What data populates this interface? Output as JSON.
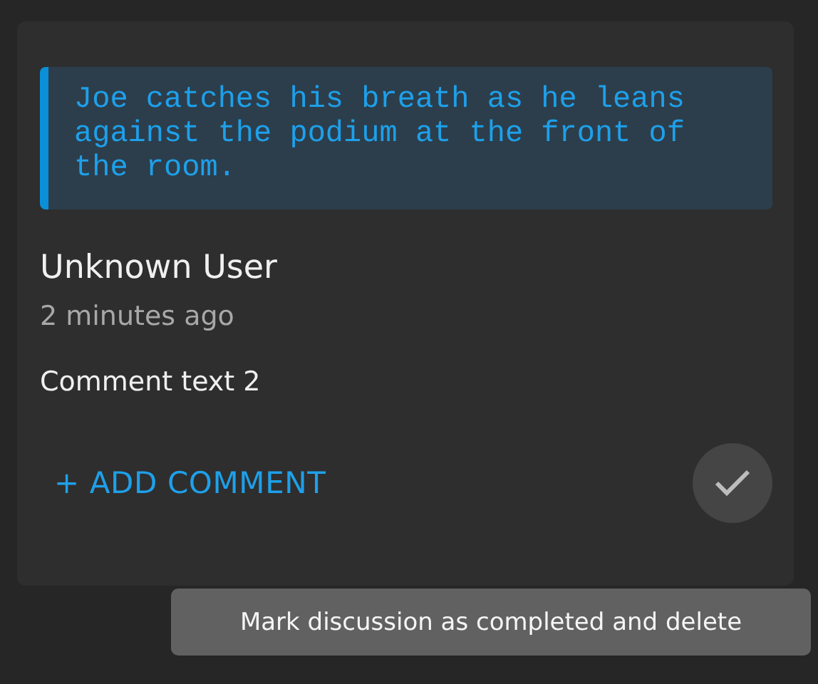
{
  "quote": "Joe catches his breath as he leans against the podium at the front of the room.",
  "comment": {
    "author": "Unknown User",
    "time": "2 minutes ago",
    "text": "Comment text 2"
  },
  "add_comment": "+ ADD COMMENT",
  "tooltip": "Mark discussion as completed and delete"
}
